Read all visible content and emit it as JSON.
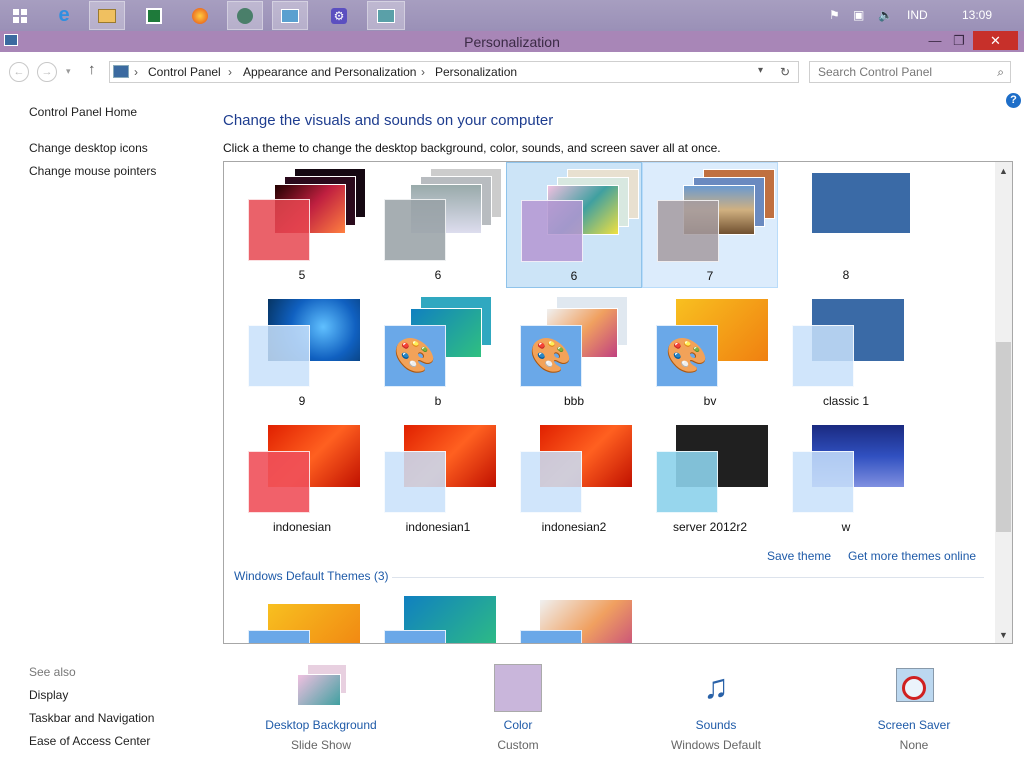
{
  "window": {
    "title": "Personalization",
    "minimize": "—",
    "maximize": "❐",
    "close": "✕"
  },
  "tray": {
    "lang": "IND",
    "time": "13:09"
  },
  "address": {
    "crumbs": [
      "Control Panel",
      "Appearance and Personalization",
      "Personalization"
    ],
    "search_placeholder": "Search Control Panel"
  },
  "sidebar": {
    "home": "Control Panel Home",
    "links": [
      "Change desktop icons",
      "Change mouse pointers"
    ],
    "see_also_title": "See also",
    "see_also": [
      "Display",
      "Taskbar and Navigation",
      "Ease of Access Center"
    ]
  },
  "main": {
    "title": "Change the visuals and sounds on your computer",
    "subtitle": "Click a theme to change the desktop background, color, sounds, and screen saver all at once.",
    "themes": [
      "5",
      "6",
      "6",
      "7",
      "8",
      "9",
      "b",
      "bbb",
      "bv",
      "classic 1",
      "indonesian",
      "indonesian1",
      "indonesian2",
      "server 2012r2",
      "w"
    ],
    "save_theme": "Save theme",
    "get_more": "Get more themes online",
    "default_header": "Windows Default Themes (3)"
  },
  "bottom": {
    "bg": {
      "label": "Desktop Background",
      "value": "Slide Show"
    },
    "color": {
      "label": "Color",
      "value": "Custom"
    },
    "sounds": {
      "label": "Sounds",
      "value": "Windows Default"
    },
    "saver": {
      "label": "Screen Saver",
      "value": "None"
    }
  },
  "colors": {
    "accent": "#1e5aa8",
    "title": "#a886b7",
    "selection": "#cce4f7"
  }
}
